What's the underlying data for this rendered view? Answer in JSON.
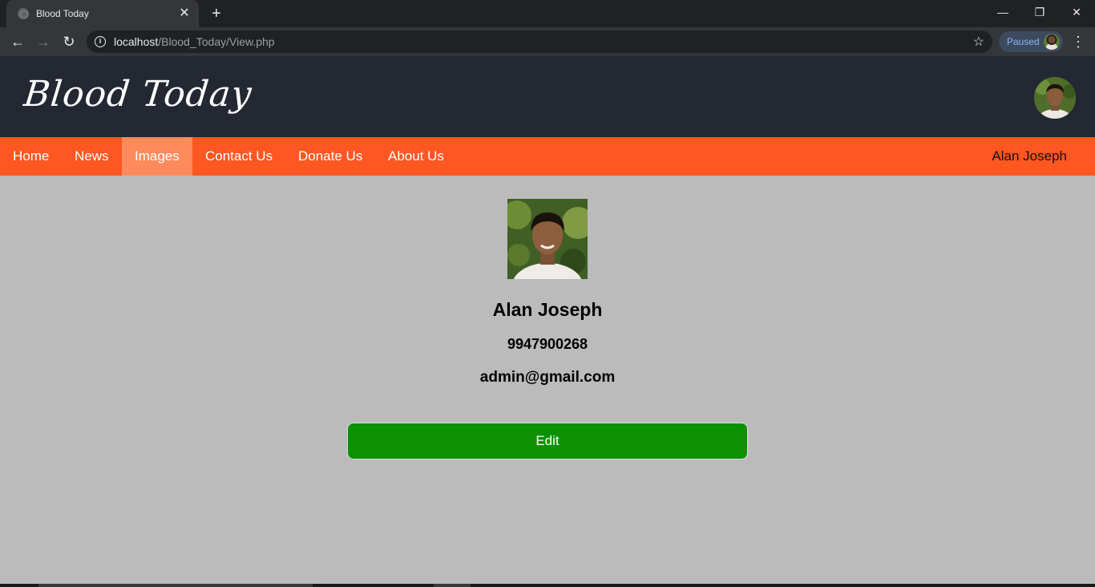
{
  "browser": {
    "tab_title": "Blood Today",
    "tab_close": "✕",
    "new_tab": "+",
    "window_controls": {
      "minimize": "—",
      "restore": "❐",
      "close": "✕"
    },
    "nav": {
      "back": "←",
      "forward": "→",
      "reload": "↻"
    },
    "address_host": "localhost",
    "address_path": "/Blood_Today/View.php",
    "star": "☆",
    "profile_status": "Paused",
    "menu_glyph": "⋮"
  },
  "site": {
    "logo": "Blood Today",
    "menu": [
      {
        "label": "Home"
      },
      {
        "label": "News"
      },
      {
        "label": "Images",
        "active": true
      },
      {
        "label": "Contact Us"
      },
      {
        "label": "Donate Us"
      },
      {
        "label": "About Us"
      }
    ],
    "user_name": "Alan Joseph"
  },
  "profile": {
    "name": "Alan Joseph",
    "phone": "9947900268",
    "email": "admin@gmail.com",
    "edit_label": "Edit"
  },
  "colors": {
    "header_bg": "#232833",
    "menu_bg": "#ff5722",
    "menu_active_bg": "#ff8a5c",
    "page_bg": "#bbbbbb",
    "edit_button_bg": "#0b9103"
  }
}
